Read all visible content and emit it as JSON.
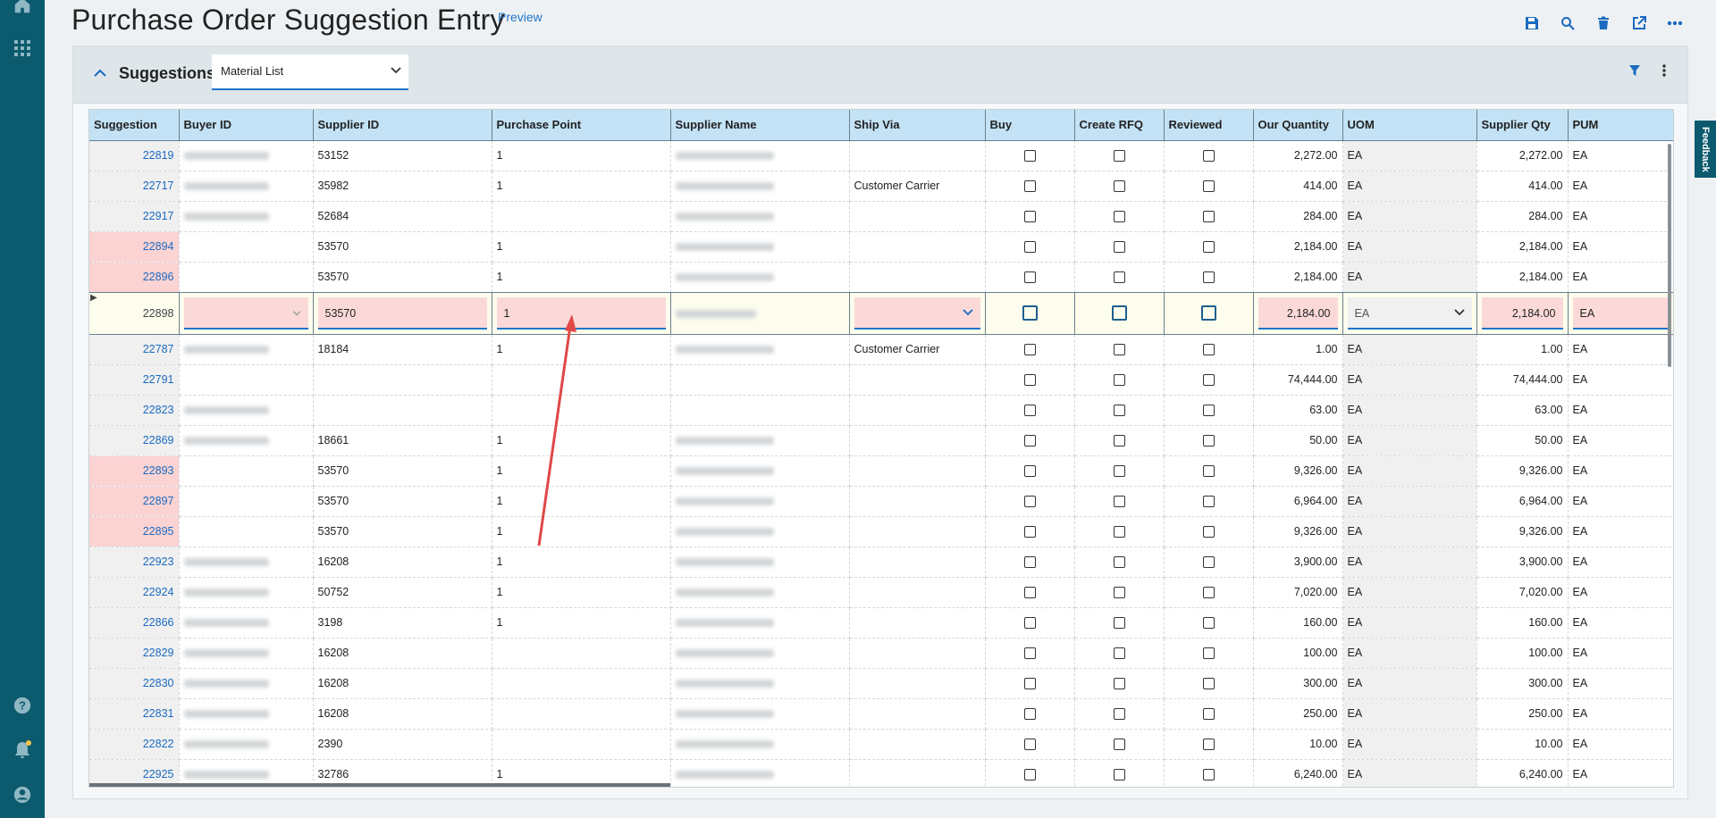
{
  "app": {
    "title": "Purchase Order Suggestion Entry",
    "preview_label": "Preview",
    "feedback_label": "Feedback"
  },
  "rail": {
    "icons": [
      "home-icon",
      "apps-grid-icon",
      "help-icon",
      "notifications-icon",
      "account-icon"
    ],
    "notification_dot_color": "#f5c542"
  },
  "toolbar": {
    "icons": [
      "save-icon",
      "search-icon",
      "delete-icon",
      "open-external-icon",
      "more-icon"
    ]
  },
  "panel": {
    "title": "Suggestions",
    "view_select_value": "Material List"
  },
  "grid": {
    "columns": [
      "Suggestion",
      "Buyer ID",
      "Supplier ID",
      "Purchase Point",
      "Supplier Name",
      "Ship Via",
      "Buy",
      "Create RFQ",
      "Reviewed",
      "Our Quantity",
      "UOM",
      "Supplier Qty",
      "PUM"
    ],
    "active_row": {
      "suggestion": "22898",
      "supplier_id": "53570",
      "purchase_point": "1",
      "our_qty": "2,184.00",
      "uom": "EA",
      "supplier_qty": "2,184.00",
      "pum": "EA"
    },
    "rows": [
      {
        "suggestion": "22819",
        "flag": false,
        "buyer": true,
        "supplier_id": "53152",
        "purchase_point": "1",
        "supplier_name": true,
        "ship_via": "",
        "our_qty": "2,272.00",
        "uom": "EA",
        "supplier_qty": "2,272.00",
        "pum": "EA"
      },
      {
        "suggestion": "22717",
        "flag": false,
        "buyer": true,
        "supplier_id": "35982",
        "purchase_point": "1",
        "supplier_name": true,
        "ship_via": "Customer Carrier",
        "our_qty": "414.00",
        "uom": "EA",
        "supplier_qty": "414.00",
        "pum": "EA"
      },
      {
        "suggestion": "22917",
        "flag": false,
        "buyer": true,
        "supplier_id": "52684",
        "purchase_point": "",
        "supplier_name": true,
        "ship_via": "",
        "our_qty": "284.00",
        "uom": "EA",
        "supplier_qty": "284.00",
        "pum": "EA"
      },
      {
        "suggestion": "22894",
        "flag": true,
        "buyer": false,
        "supplier_id": "53570",
        "purchase_point": "1",
        "supplier_name": true,
        "ship_via": "",
        "our_qty": "2,184.00",
        "uom": "EA",
        "supplier_qty": "2,184.00",
        "pum": "EA"
      },
      {
        "suggestion": "22896",
        "flag": true,
        "buyer": false,
        "supplier_id": "53570",
        "purchase_point": "1",
        "supplier_name": true,
        "ship_via": "",
        "our_qty": "2,184.00",
        "uom": "EA",
        "supplier_qty": "2,184.00",
        "pum": "EA"
      },
      {
        "active": true
      },
      {
        "suggestion": "22787",
        "flag": false,
        "buyer": true,
        "supplier_id": "18184",
        "purchase_point": "1",
        "supplier_name": true,
        "ship_via": "Customer Carrier",
        "our_qty": "1.00",
        "uom": "EA",
        "supplier_qty": "1.00",
        "pum": "EA"
      },
      {
        "suggestion": "22791",
        "flag": false,
        "buyer": false,
        "supplier_id": "",
        "purchase_point": "",
        "supplier_name": false,
        "ship_via": "",
        "our_qty": "74,444.00",
        "uom": "EA",
        "supplier_qty": "74,444.00",
        "pum": "EA"
      },
      {
        "suggestion": "22823",
        "flag": false,
        "buyer": true,
        "supplier_id": "",
        "purchase_point": "",
        "supplier_name": false,
        "ship_via": "",
        "our_qty": "63.00",
        "uom": "EA",
        "supplier_qty": "63.00",
        "pum": "EA"
      },
      {
        "suggestion": "22869",
        "flag": false,
        "buyer": true,
        "supplier_id": "18661",
        "purchase_point": "1",
        "supplier_name": true,
        "ship_via": "",
        "our_qty": "50.00",
        "uom": "EA",
        "supplier_qty": "50.00",
        "pum": "EA"
      },
      {
        "suggestion": "22893",
        "flag": true,
        "buyer": false,
        "supplier_id": "53570",
        "purchase_point": "1",
        "supplier_name": true,
        "ship_via": "",
        "our_qty": "9,326.00",
        "uom": "EA",
        "supplier_qty": "9,326.00",
        "pum": "EA"
      },
      {
        "suggestion": "22897",
        "flag": true,
        "buyer": false,
        "supplier_id": "53570",
        "purchase_point": "1",
        "supplier_name": true,
        "ship_via": "",
        "our_qty": "6,964.00",
        "uom": "EA",
        "supplier_qty": "6,964.00",
        "pum": "EA"
      },
      {
        "suggestion": "22895",
        "flag": true,
        "buyer": false,
        "supplier_id": "53570",
        "purchase_point": "1",
        "supplier_name": true,
        "ship_via": "",
        "our_qty": "9,326.00",
        "uom": "EA",
        "supplier_qty": "9,326.00",
        "pum": "EA"
      },
      {
        "suggestion": "22923",
        "flag": false,
        "buyer": true,
        "supplier_id": "16208",
        "purchase_point": "1",
        "supplier_name": true,
        "ship_via": "",
        "our_qty": "3,900.00",
        "uom": "EA",
        "supplier_qty": "3,900.00",
        "pum": "EA"
      },
      {
        "suggestion": "22924",
        "flag": false,
        "buyer": true,
        "supplier_id": "50752",
        "purchase_point": "1",
        "supplier_name": true,
        "ship_via": "",
        "our_qty": "7,020.00",
        "uom": "EA",
        "supplier_qty": "7,020.00",
        "pum": "EA"
      },
      {
        "suggestion": "22866",
        "flag": false,
        "buyer": true,
        "supplier_id": "3198",
        "purchase_point": "1",
        "supplier_name": true,
        "ship_via": "",
        "our_qty": "160.00",
        "uom": "EA",
        "supplier_qty": "160.00",
        "pum": "EA"
      },
      {
        "suggestion": "22829",
        "flag": false,
        "buyer": true,
        "supplier_id": "16208",
        "purchase_point": "",
        "supplier_name": true,
        "ship_via": "",
        "our_qty": "100.00",
        "uom": "EA",
        "supplier_qty": "100.00",
        "pum": "EA"
      },
      {
        "suggestion": "22830",
        "flag": false,
        "buyer": true,
        "supplier_id": "16208",
        "purchase_point": "",
        "supplier_name": true,
        "ship_via": "",
        "our_qty": "300.00",
        "uom": "EA",
        "supplier_qty": "300.00",
        "pum": "EA"
      },
      {
        "suggestion": "22831",
        "flag": false,
        "buyer": true,
        "supplier_id": "16208",
        "purchase_point": "",
        "supplier_name": true,
        "ship_via": "",
        "our_qty": "250.00",
        "uom": "EA",
        "supplier_qty": "250.00",
        "pum": "EA"
      },
      {
        "suggestion": "22822",
        "flag": false,
        "buyer": true,
        "supplier_id": "2390",
        "purchase_point": "",
        "supplier_name": true,
        "ship_via": "",
        "our_qty": "10.00",
        "uom": "EA",
        "supplier_qty": "10.00",
        "pum": "EA"
      },
      {
        "suggestion": "22925",
        "flag": false,
        "buyer": true,
        "supplier_id": "32786",
        "purchase_point": "1",
        "supplier_name": true,
        "ship_via": "",
        "our_qty": "6,240.00",
        "uom": "EA",
        "supplier_qty": "6,240.00",
        "pum": "EA"
      }
    ]
  },
  "colors": {
    "rail": "#0b5a6e",
    "header": "#c3e2f5",
    "flag": "#fbd3d3",
    "link": "#1b6ac0",
    "annotation_arrow": "#e04848"
  }
}
